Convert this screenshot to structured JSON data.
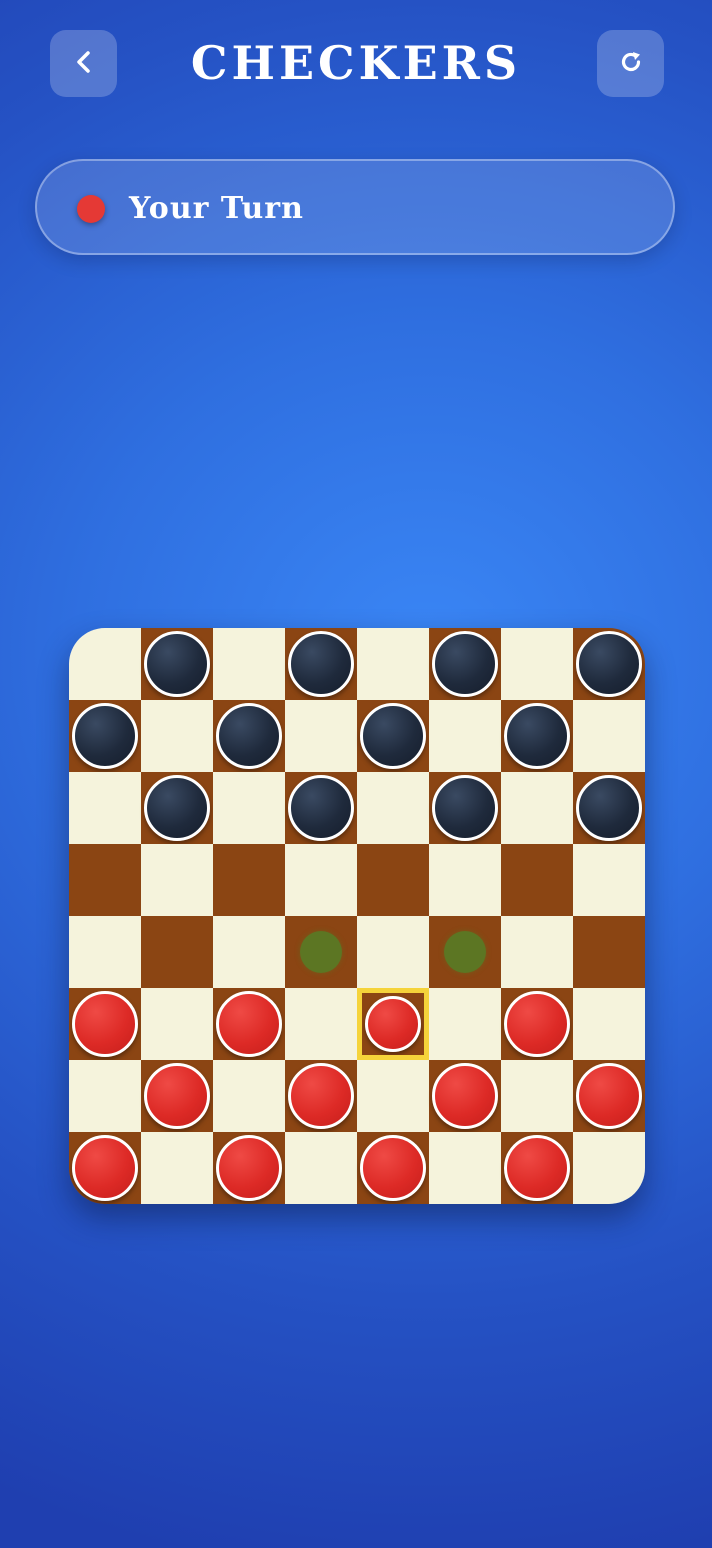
{
  "header": {
    "title": "CHECKERS",
    "back_icon": "chevron-left-icon",
    "reset_icon": "refresh-icon"
  },
  "status": {
    "text": "Your Turn",
    "player_color": "#e53935"
  },
  "colors": {
    "light_square": "#f5f3dc",
    "dark_square": "#8b4513",
    "red_piece": "#dd2a26",
    "black_piece": "#1f2a3c",
    "selection": "#f5d33a",
    "move_hint": "#508228"
  },
  "board": {
    "rows": [
      ". b . b . b . b",
      "b . b . b . b .",
      ". b . b . b . b",
      ". . . . . . . .",
      ". . . h . h . .",
      "r . r . s . r .",
      ". r . r . r . r",
      "r . r . r . r ."
    ]
  }
}
